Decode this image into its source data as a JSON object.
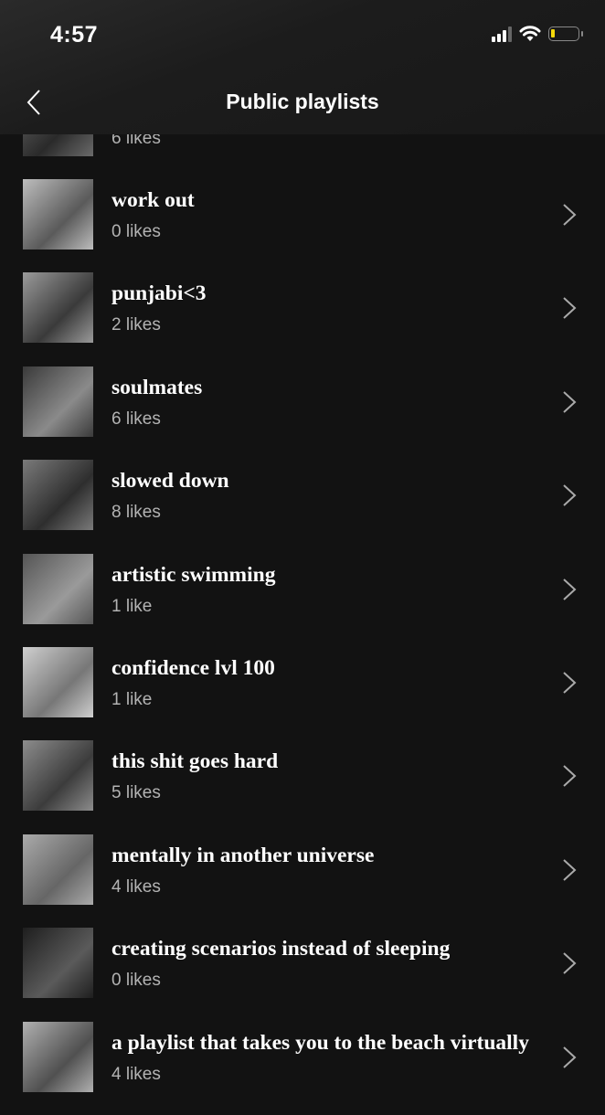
{
  "status_bar": {
    "time": "4:57",
    "icons": [
      "signal-icon",
      "wifi-icon",
      "battery-low-icon"
    ],
    "battery_color": "#f5d90a"
  },
  "header": {
    "title": "Public playlists",
    "back_icon": "chevron-left-icon"
  },
  "playlists": [
    {
      "name": "",
      "likes": "6 likes",
      "thumb": [
        "#6a6a6a",
        "#2a2a2a"
      ]
    },
    {
      "name": "work out",
      "likes": "0 likes",
      "thumb": [
        "#bdbdbd",
        "#5a5a5a"
      ]
    },
    {
      "name": "punjabi<3",
      "likes": "2 likes",
      "thumb": [
        "#9a9a9a",
        "#3a3a3a"
      ]
    },
    {
      "name": "soulmates",
      "likes": "6 likes",
      "thumb": [
        "#3a3a3a",
        "#8a8a8a"
      ]
    },
    {
      "name": "slowed down",
      "likes": "8 likes",
      "thumb": [
        "#7a7a7a",
        "#2e2e2e"
      ]
    },
    {
      "name": "artistic swimming",
      "likes": "1 like",
      "thumb": [
        "#555555",
        "#9a9a9a"
      ]
    },
    {
      "name": "confidence lvl 100",
      "likes": "1 like",
      "thumb": [
        "#cfcfcf",
        "#777777"
      ]
    },
    {
      "name": "this shit goes hard",
      "likes": "5 likes",
      "thumb": [
        "#8c8c8c",
        "#3c3c3c"
      ]
    },
    {
      "name": "mentally in another universe",
      "likes": "4 likes",
      "thumb": [
        "#aaaaaa",
        "#666666"
      ]
    },
    {
      "name": "creating scenarios instead of sleeping",
      "likes": "0 likes",
      "thumb": [
        "#1e1e1e",
        "#5a5a5a"
      ]
    },
    {
      "name": "a playlist that takes you to the beach virtually",
      "likes": "4 likes",
      "thumb": [
        "#b0b0b0",
        "#505050"
      ]
    }
  ]
}
